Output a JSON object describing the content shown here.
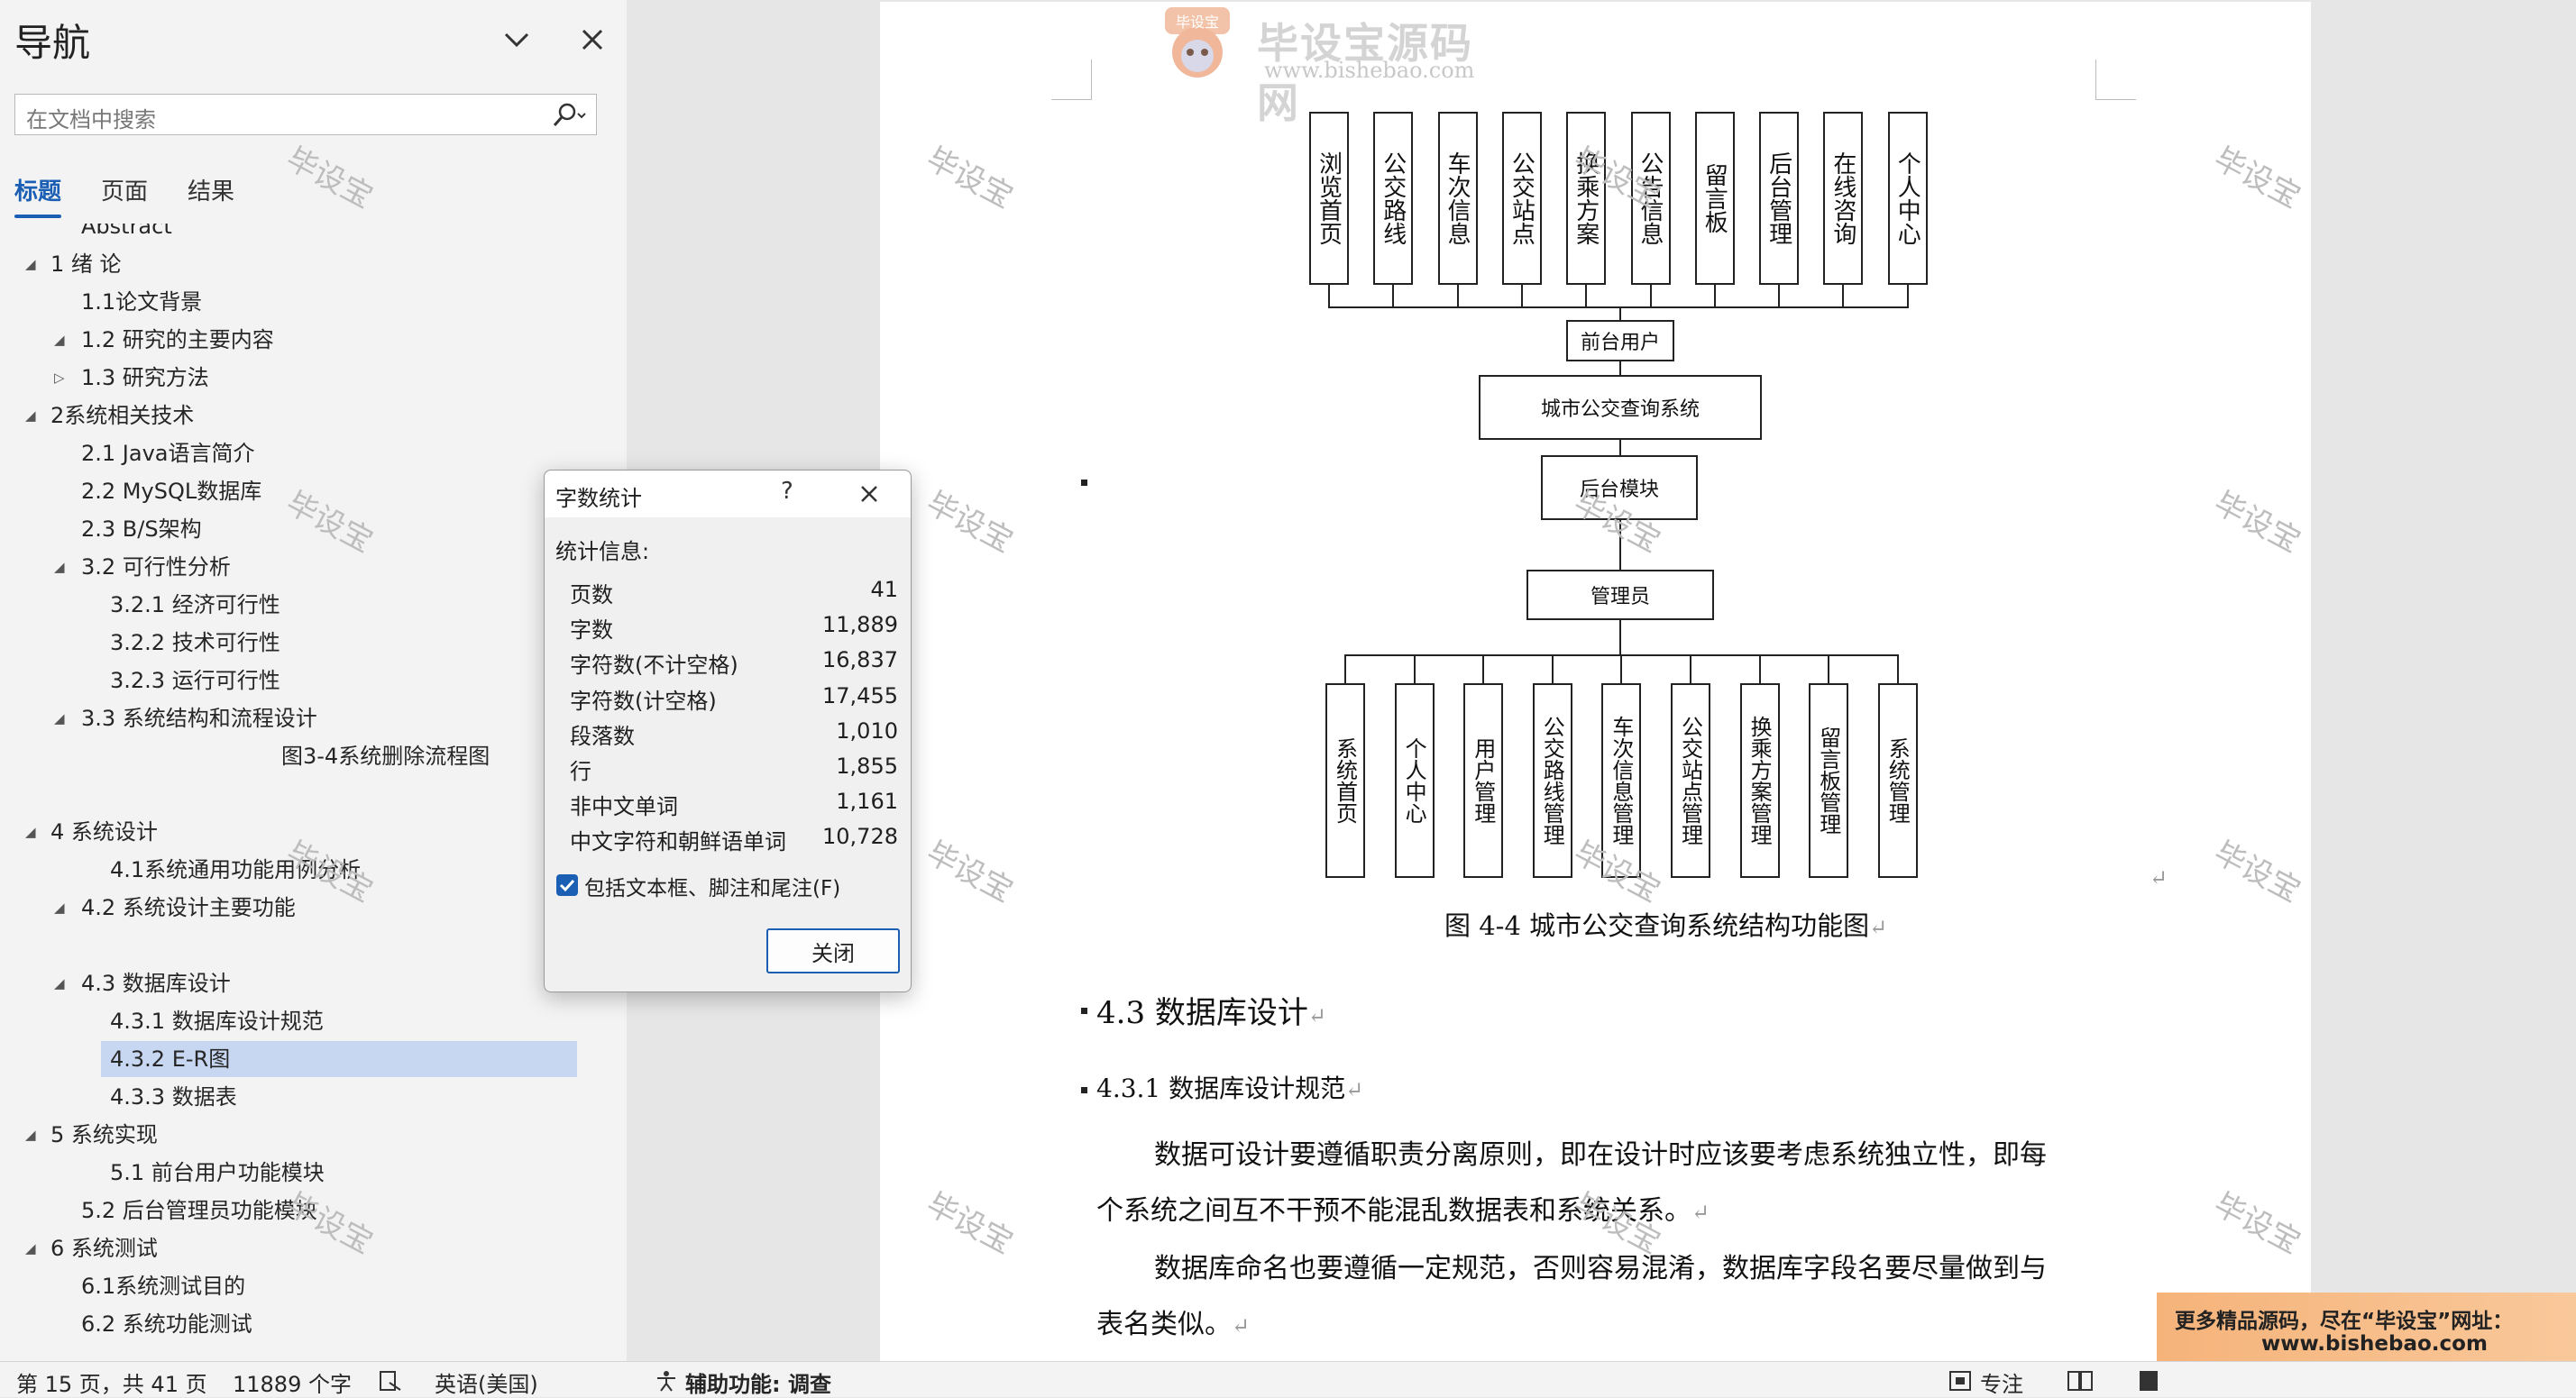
{
  "nav": {
    "title": "导航",
    "search_placeholder": "在文档中搜索",
    "tabs": [
      "标题",
      "页面",
      "结果"
    ],
    "tree": [
      {
        "label": "Abstract",
        "expander": ""
      },
      {
        "label": "1 绪  论",
        "expander": "expanded"
      },
      {
        "label": "1.1论文背景",
        "expander": ""
      },
      {
        "label": "1.2 研究的主要内容",
        "expander": "expanded"
      },
      {
        "label": "1.3 研究方法",
        "expander": "collapsed"
      },
      {
        "label": "2系统相关技术",
        "expander": "expanded"
      },
      {
        "label": "2.1 Java语言简介",
        "expander": ""
      },
      {
        "label": "2.2  MySQL数据库",
        "expander": ""
      },
      {
        "label": "2.3 B/S架构",
        "expander": ""
      },
      {
        "label": "3.2 可行性分析",
        "expander": "expanded"
      },
      {
        "label": "3.2.1 经济可行性",
        "expander": ""
      },
      {
        "label": "3.2.2 技术可行性",
        "expander": ""
      },
      {
        "label": "3.2.3 运行可行性",
        "expander": ""
      },
      {
        "label": "3.3 系统结构和流程设计",
        "expander": "expanded"
      },
      {
        "label": "图3-4系统删除流程图",
        "expander": ""
      },
      {
        "label": "4 系统设计",
        "expander": "expanded"
      },
      {
        "label": "4.1系统通用功能用例分析",
        "expander": ""
      },
      {
        "label": "4.2 系统设计主要功能",
        "expander": "expanded"
      },
      {
        "label": "4.3 数据库设计",
        "expander": "expanded"
      },
      {
        "label": "4.3.1 数据库设计规范",
        "expander": ""
      },
      {
        "label": "4.3.2 E-R图",
        "expander": "",
        "selected": true
      },
      {
        "label": "4.3.3 数据表",
        "expander": ""
      },
      {
        "label": "5 系统实现",
        "expander": "expanded"
      },
      {
        "label": "5.1 前台用户功能模块",
        "expander": ""
      },
      {
        "label": "5.2 后台管理员功能模块",
        "expander": ""
      },
      {
        "label": "6 系统测试",
        "expander": "expanded"
      },
      {
        "label": "6.1系统测试目的",
        "expander": ""
      },
      {
        "label": "6.2 系统功能测试",
        "expander": ""
      }
    ]
  },
  "watermark": "毕设宝",
  "logo": {
    "badge": "毕设宝",
    "name": "毕设宝源码网",
    "url": "www.bishebao.com"
  },
  "diagram": {
    "front_modules": [
      "浏览首页",
      "公交路线",
      "车次信息",
      "公交站点",
      "换乘方案",
      "公告信息",
      "留言板",
      "后台管理",
      "在线咨询",
      "个人中心"
    ],
    "front_user": "前台用户",
    "system": "城市公交查询系统",
    "backend": "后台模块",
    "admin": "管理员",
    "admin_modules": [
      "系统首页",
      "个人中心",
      "用户管理",
      "公交路线管理",
      "车次信息管理",
      "公交站点管理",
      "换乘方案管理",
      "留言板管理",
      "系统管理"
    ]
  },
  "document": {
    "figure_caption": "图 4-4 城市公交查询系统结构功能图",
    "heading_2": "4.3  数据库设计",
    "heading_3": "4.3.1  数据库设计规范",
    "para1_line1": "数据可设计要遵循职责分离原则，即在设计时应该要考虑系统独立性，即每",
    "para1_line2": "个系统之间互不干预不能混乱数据表和系统关系。",
    "para2_line1": "数据库命名也要遵循一定规范，否则容易混淆，数据库字段名要尽量做到与",
    "para2_line2": "表名类似。",
    "pilcrow": "↵"
  },
  "ad": {
    "line1": "更多精品源码，尽在“毕设宝”网址：",
    "line2": "www.bishebao.com"
  },
  "dialog": {
    "title": "字数统计",
    "help": "?",
    "stats_label": "统计信息:",
    "rows": [
      {
        "label": "页数",
        "value": "41"
      },
      {
        "label": "字数",
        "value": "11,889"
      },
      {
        "label": "字符数(不计空格)",
        "value": "16,837"
      },
      {
        "label": "字符数(计空格)",
        "value": "17,455"
      },
      {
        "label": "段落数",
        "value": "1,010"
      },
      {
        "label": "行",
        "value": "1,855"
      },
      {
        "label": "非中文单词",
        "value": "1,161"
      },
      {
        "label": "中文字符和朝鲜语单词",
        "value": "10,728"
      }
    ],
    "checkbox_label": "包括文本框、脚注和尾注(F)",
    "checkbox_checked": true,
    "close_label": "关闭"
  },
  "status": {
    "page": "第 15 页，共 41 页",
    "words": "11889 个字",
    "language": "英语(美国)",
    "accessibility": "辅助功能: 调查",
    "focus": "专注"
  },
  "colors": {
    "accent": "#1a5fb4",
    "selection": "#c7d7f1",
    "ad_orange": "#f5b37a"
  }
}
